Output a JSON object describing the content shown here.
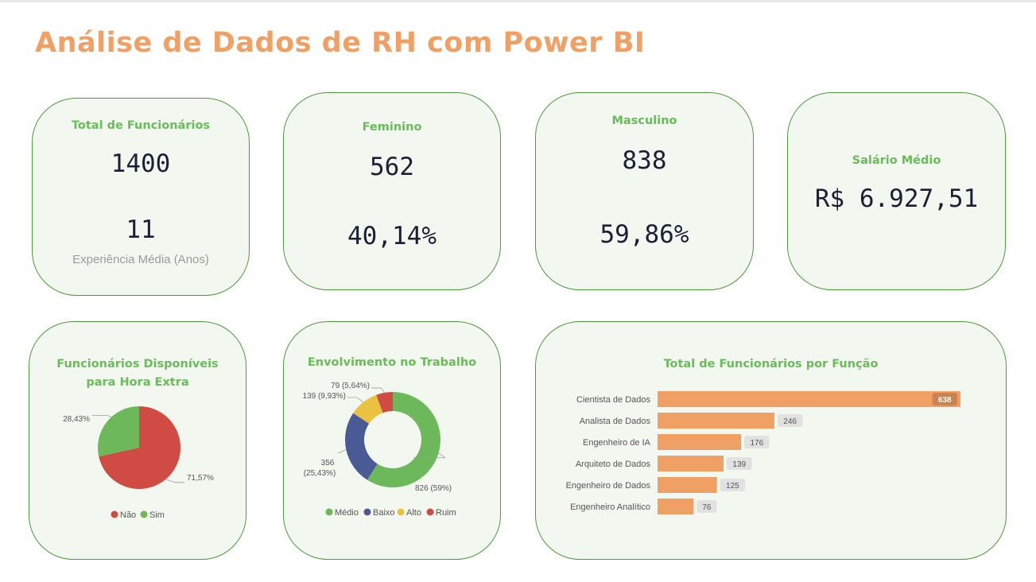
{
  "title": "Análise de Dados de RH com Power BI",
  "kpis": {
    "total": {
      "label": "Total de Funcionários",
      "value": "1400",
      "exp_value": "11",
      "exp_label": "Experiência Média (Anos)"
    },
    "feminino": {
      "label": "Feminino",
      "value": "562",
      "pct": "40,14%"
    },
    "masculino": {
      "label": "Masculino",
      "value": "838",
      "pct": "59,86%"
    },
    "salario": {
      "label": "Salário Médio",
      "value": "R$ 6.927,51"
    }
  },
  "colors": {
    "title": "#f0a064",
    "card_bg": "#f2f8ef",
    "card_border": "#4e9a3e",
    "card_title": "#6abb5a",
    "nao": "#cf4b44",
    "sim": "#6db85a",
    "medio": "#6db85a",
    "baixo": "#4a5a94",
    "alto": "#ebc23f",
    "ruim": "#cf4b44",
    "bar": "#f0a064"
  },
  "chart_data": [
    {
      "type": "pie",
      "title_line1": "Funcionários Disponíveis",
      "title_line2": "para Hora Extra",
      "legend_position": "bottom",
      "slices": [
        {
          "name": "Não",
          "value": 71.57,
          "label": "71,57%"
        },
        {
          "name": "Sim",
          "value": 28.43,
          "label": "28,43%"
        }
      ]
    },
    {
      "type": "pie",
      "variant": "donut",
      "title": "Envolvimento no Trabalho",
      "legend_position": "bottom",
      "slices": [
        {
          "name": "Médio",
          "value": 826,
          "label": "826 (59%)"
        },
        {
          "name": "Baixo",
          "value": 356,
          "label_line1": "356",
          "label_line2": "(25,43%)"
        },
        {
          "name": "Alto",
          "value": 139,
          "label": "139 (9,93%)"
        },
        {
          "name": "Ruim",
          "value": 79,
          "label": "79 (5,64%)"
        }
      ]
    },
    {
      "type": "bar",
      "orientation": "horizontal",
      "title": "Total de Funcionários por Função",
      "categories": [
        "Cientista de Dados",
        "Analista de Dados",
        "Engenheiro de IA",
        "Arquiteto de Dados",
        "Engenheiro de Dados",
        "Engenheiro Analítico"
      ],
      "values": [
        638,
        246,
        176,
        139,
        125,
        76
      ],
      "xlim": [
        0,
        638
      ]
    }
  ]
}
